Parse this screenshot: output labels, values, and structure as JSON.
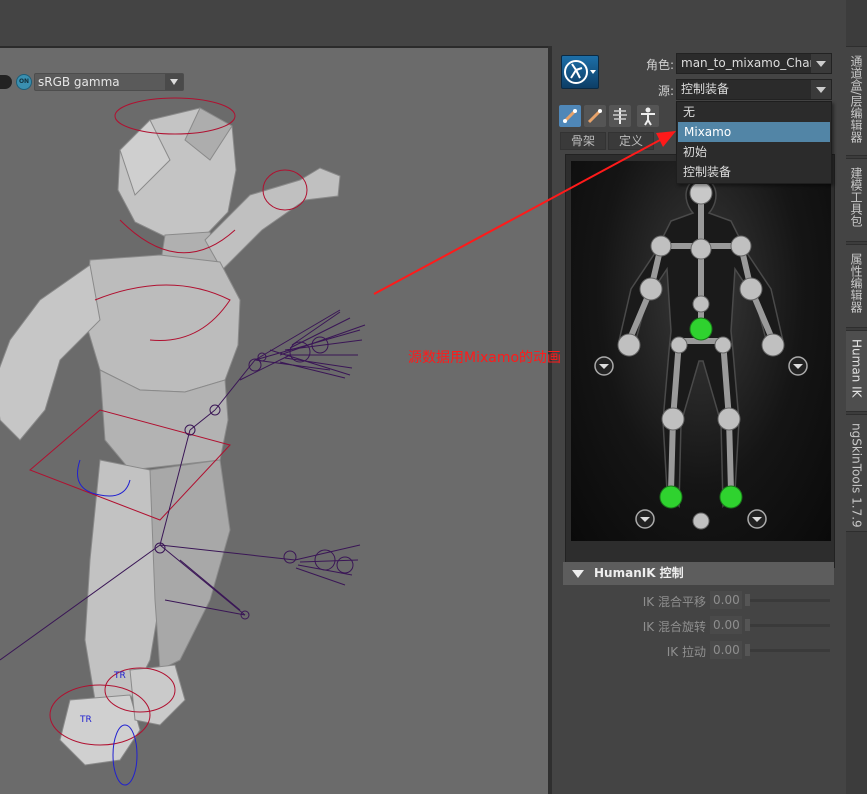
{
  "viewport": {
    "color_management": {
      "on_badge": "ON",
      "view_transform": "sRGB gamma"
    },
    "manipulator_labels": [
      "TR",
      "TR"
    ]
  },
  "humanik": {
    "character_label": "角色:",
    "character_value": "man_to_mixamo_Chara",
    "source_label": "源:",
    "source_value": "控制装备",
    "tabs": [
      "骨架",
      "定义"
    ],
    "source_dropdown": {
      "items": [
        "无",
        "Mixamo",
        "初始",
        "控制装备"
      ],
      "selected": "Mixamo"
    },
    "controls": {
      "header": "HumanIK 控制",
      "rows": [
        {
          "label": "IK 混合平移",
          "value": "0.00"
        },
        {
          "label": "IK 混合旋转",
          "value": "0.00"
        },
        {
          "label": "IK 拉动",
          "value": "0.00"
        }
      ]
    }
  },
  "side_tabs": [
    "通道盒/层编辑器",
    "建模工具包",
    "属性编辑器",
    "Human IK",
    "ngSkinTools 1.7.9"
  ],
  "active_side_tab": "Human IK",
  "annotation": {
    "text": "源数据用Mixamo的动画",
    "color": "#ff1a1a"
  },
  "colors": {
    "viewport_bg": "#6b6b6b",
    "panel_bg": "#444444",
    "selection_blue": "#5285a6",
    "effector_green": "#2fd22f",
    "skeleton_purple": "#3a1656"
  }
}
